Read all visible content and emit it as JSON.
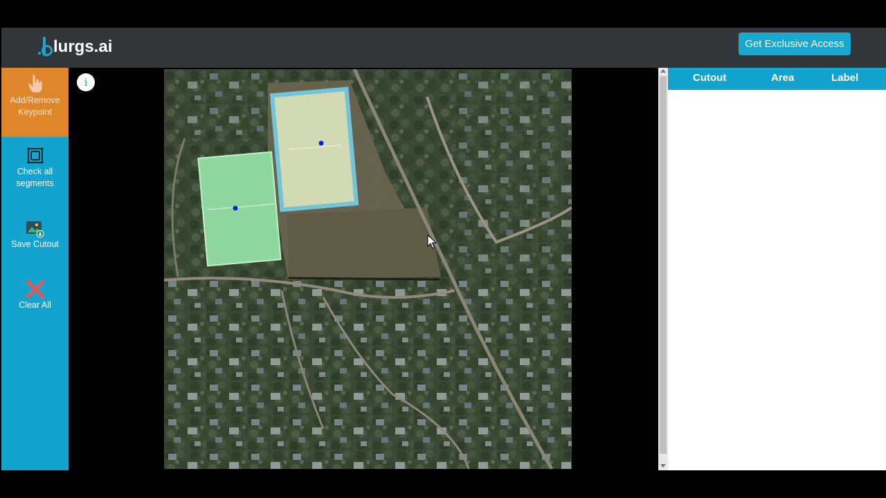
{
  "header": {
    "logo_text": "lurgs.ai",
    "cta_label": "Get Exclusive Access"
  },
  "toolbar": {
    "items": [
      {
        "label": "Add/Remove Keypoint",
        "icon": "hand-pointer-icon",
        "active": true
      },
      {
        "label": "Check all segments",
        "icon": "segments-frame-icon",
        "active": false
      },
      {
        "label": "Save Cutout",
        "icon": "image-save-icon",
        "active": false
      },
      {
        "label": "Clear All",
        "icon": "close-icon",
        "active": false
      }
    ]
  },
  "viewer": {
    "info_label": "i"
  },
  "table": {
    "columns": [
      "Cutout",
      "Area",
      "Label"
    ],
    "rows": []
  },
  "colors": {
    "brand": "#17a7cf",
    "toolbar": "#12a4cf",
    "active_tool": "#e0862a",
    "topbar": "#333638"
  }
}
